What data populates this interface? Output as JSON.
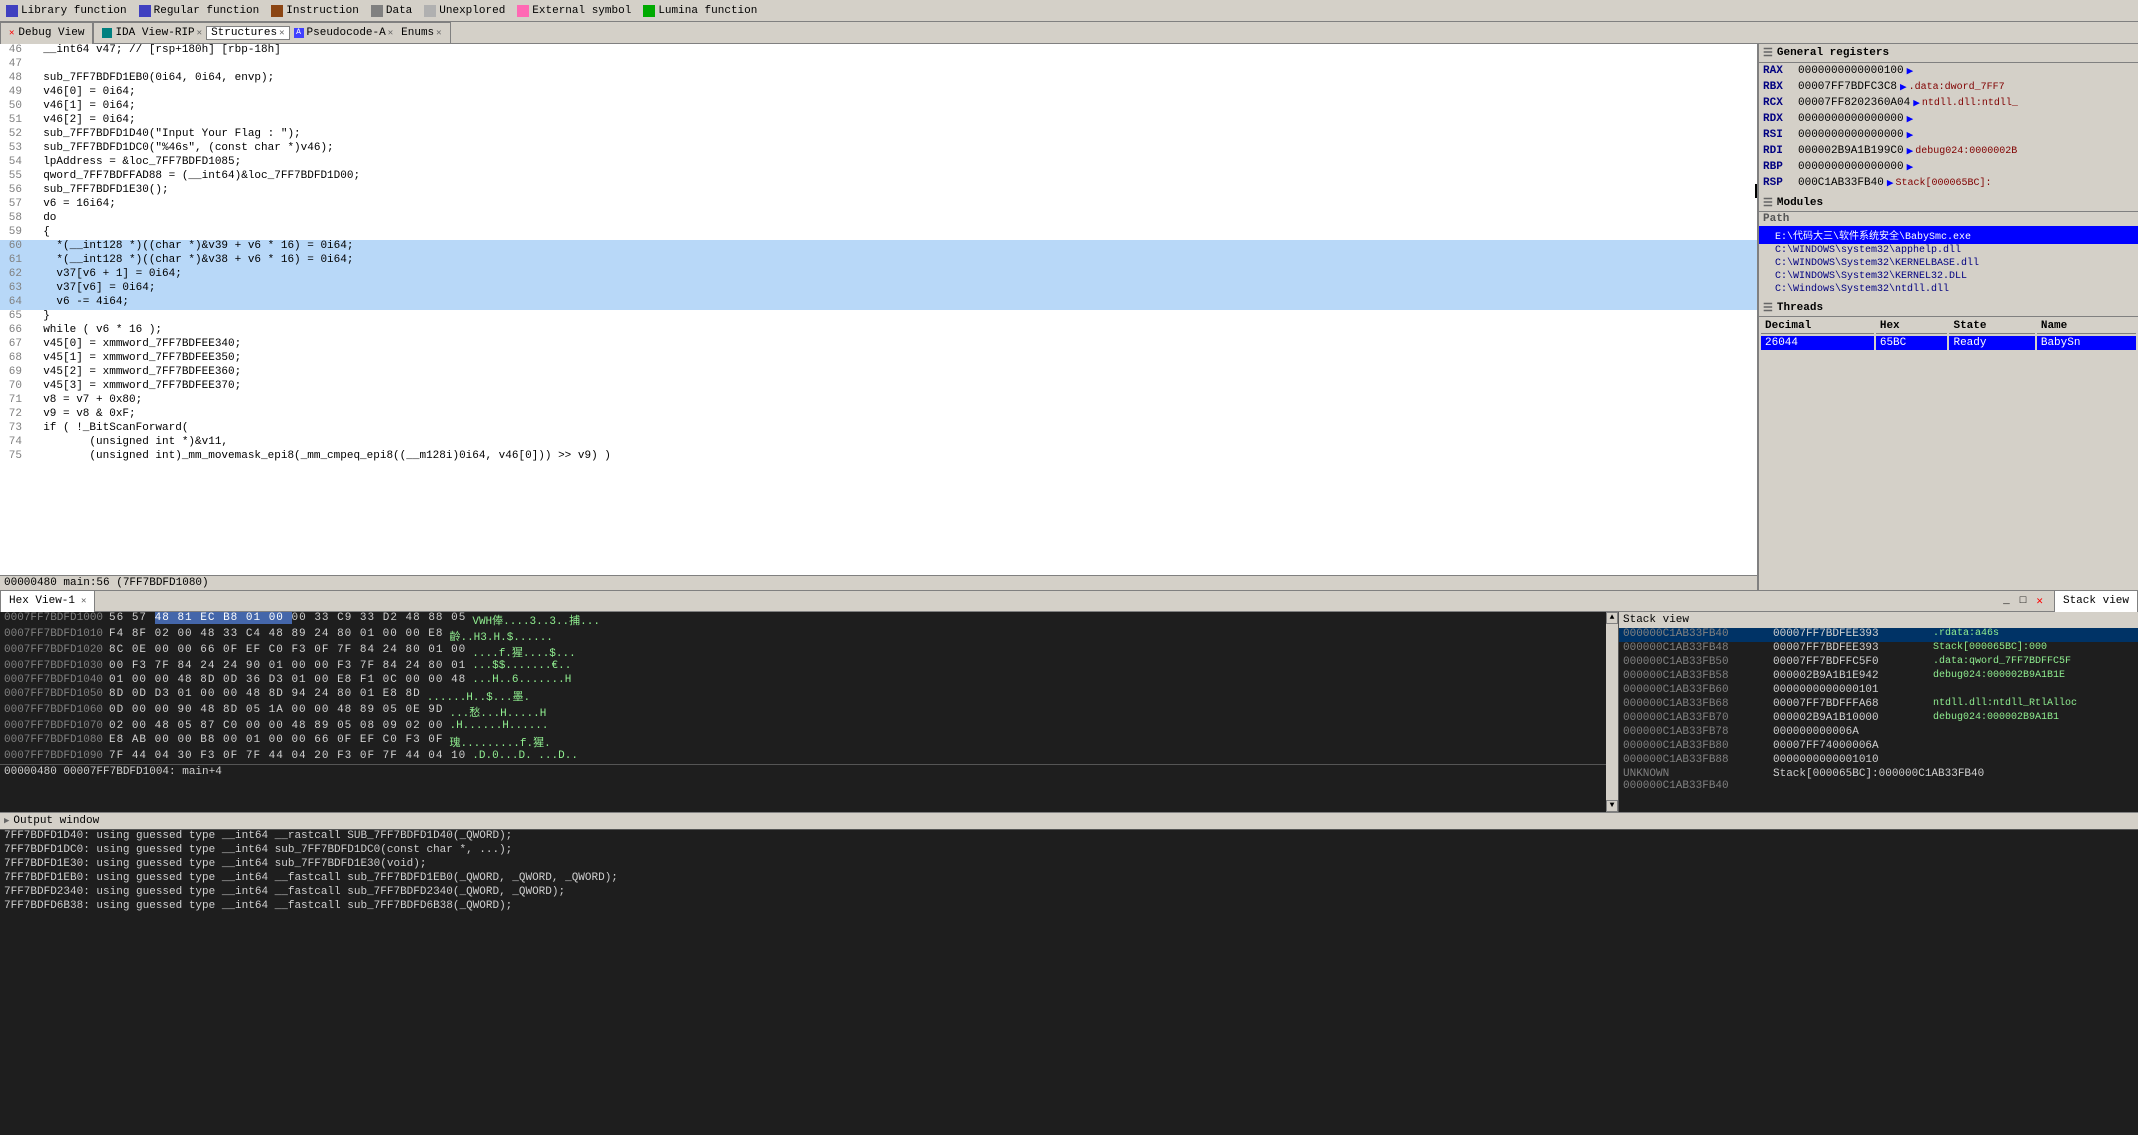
{
  "legend": {
    "items": [
      {
        "label": "Library function",
        "color": "#4040c0"
      },
      {
        "label": "Regular function",
        "color": "#4040c0"
      },
      {
        "label": "Instruction",
        "color": "#8b4513"
      },
      {
        "label": "Data",
        "color": "#808080"
      },
      {
        "label": "Unexplored",
        "color": "#808080"
      },
      {
        "label": "External symbol",
        "color": "#ff69b4"
      },
      {
        "label": "Lumina function",
        "color": "#00aa00"
      }
    ]
  },
  "tabs": {
    "debug_view": "Debug View",
    "ida_view_rip": "IDA View-RIP",
    "structures": "Structures",
    "pseudocode": "Pseudocode-A",
    "enums": "Enums"
  },
  "code_panel": {
    "title": "Pseudocode-A",
    "lines": [
      {
        "num": "46",
        "text": "  __int64 v47; // [rsp+180h] [rbp-18h]",
        "highlight": false
      },
      {
        "num": "47",
        "text": "",
        "highlight": false
      },
      {
        "num": "48",
        "text": "  sub_7FF7BDFD1EB0(0i64, 0i64, envp);",
        "highlight": false
      },
      {
        "num": "49",
        "text": "  v46[0] = 0i64;",
        "highlight": false
      },
      {
        "num": "50",
        "text": "  v46[1] = 0i64;",
        "highlight": false
      },
      {
        "num": "51",
        "text": "  v46[2] = 0i64;",
        "highlight": false
      },
      {
        "num": "52",
        "text": "  sub_7FF7BDFD1D40(\"Input Your Flag : \");",
        "highlight": false
      },
      {
        "num": "53",
        "text": "  sub_7FF7BDFD1DC0(\"%46s\", (const char *)v46);",
        "highlight": false
      },
      {
        "num": "54",
        "text": "  lpAddress = &loc_7FF7BDFD1085;",
        "highlight": false
      },
      {
        "num": "55",
        "text": "  qword_7FF7BDFFAD88 = (__int64)&loc_7FF7BDFD1D00;",
        "highlight": false
      },
      {
        "num": "56",
        "text": "  sub_7FF7BDFD1E30();",
        "highlight": false,
        "cursor": true
      },
      {
        "num": "57",
        "text": "  v6 = 16i64;",
        "highlight": false
      },
      {
        "num": "58",
        "text": "  do",
        "highlight": false
      },
      {
        "num": "59",
        "text": "  {",
        "highlight": false
      },
      {
        "num": "60",
        "text": "    *(__int128 *)((char *)&v39 + v6 * 16) = 0i64;",
        "highlight": true
      },
      {
        "num": "61",
        "text": "    *(__int128 *)((char *)&v38 + v6 * 16) = 0i64;",
        "highlight": true
      },
      {
        "num": "62",
        "text": "    v37[v6 + 1] = 0i64;",
        "highlight": true
      },
      {
        "num": "63",
        "text": "    v37[v6] = 0i64;",
        "highlight": true
      },
      {
        "num": "64",
        "text": "    v6 -= 4i64;",
        "highlight": true
      },
      {
        "num": "65",
        "text": "  }",
        "highlight": false
      },
      {
        "num": "66",
        "text": "  while ( v6 * 16 );",
        "highlight": false
      },
      {
        "num": "67",
        "text": "  v45[0] = xmmword_7FF7BDFEE340;",
        "highlight": false
      },
      {
        "num": "68",
        "text": "  v45[1] = xmmword_7FF7BDFEE350;",
        "highlight": false
      },
      {
        "num": "69",
        "text": "  v45[2] = xmmword_7FF7BDFEE360;",
        "highlight": false
      },
      {
        "num": "70",
        "text": "  v45[3] = xmmword_7FF7BDFEE370;",
        "highlight": false
      },
      {
        "num": "71",
        "text": "  v8 = v7 + 0x80;",
        "highlight": false
      },
      {
        "num": "72",
        "text": "  v9 = v8 & 0xF;",
        "highlight": false
      },
      {
        "num": "73",
        "text": "  if ( !_BitScanForward(",
        "highlight": false
      },
      {
        "num": "74",
        "text": "         (unsigned int *)&v11,",
        "highlight": false
      },
      {
        "num": "75",
        "text": "         (unsigned int)_mm_movemask_epi8(_mm_cmpeq_epi8((__m128i)0i64, v46[0])) >> v9) )",
        "highlight": false
      }
    ],
    "status": "00000480 main:56 (7FF7BDFD1080)"
  },
  "registers": {
    "title": "General registers",
    "items": [
      {
        "name": "RAX",
        "value": "0000000000000100",
        "ref": "▶",
        "ref_text": ""
      },
      {
        "name": "RBX",
        "value": "00007FF7BDFC3C8",
        "ref": "▶",
        "ref_text": ".data:dword_7FF7"
      },
      {
        "name": "RCX",
        "value": "00007FF8202360A04",
        "ref": "▶",
        "ref_text": "ntdll.dll:ntdll_"
      },
      {
        "name": "RDX",
        "value": "0000000000000000",
        "ref": "▶",
        "ref_text": ""
      },
      {
        "name": "RSI",
        "value": "0000000000000000",
        "ref": "▶",
        "ref_text": ""
      },
      {
        "name": "RDI",
        "value": "000002B9A1B199C0",
        "ref": "▶",
        "ref_text": "debug024:0000002B"
      },
      {
        "name": "RBP",
        "value": "0000000000000000",
        "ref": "▶",
        "ref_text": ""
      },
      {
        "name": "RSP",
        "value": "000C1AB33FB40",
        "ref": "▶",
        "ref_text": "Stack[000065BC]:"
      }
    ]
  },
  "modules": {
    "title": "Modules",
    "path_label": "Path",
    "items": [
      {
        "path": "E:\\代码大三\\软件系统安全\\BabySmc.exe",
        "selected": true
      },
      {
        "path": "C:\\WINDOWS\\system32\\apphelp.dll",
        "selected": false
      },
      {
        "path": "C:\\WINDOWS\\System32\\KERNELBASE.dll",
        "selected": false
      },
      {
        "path": "C:\\WINDOWS\\System32\\KERNEL32.DLL",
        "selected": false
      },
      {
        "path": "C:\\Windows\\System32\\ntdll.dll",
        "selected": false
      }
    ]
  },
  "threads": {
    "title": "Threads",
    "columns": [
      "Decimal",
      "Hex",
      "State",
      "Name"
    ],
    "rows": [
      {
        "decimal": "26044",
        "hex": "65BC",
        "state": "Ready",
        "name": "BabySn",
        "selected": true
      }
    ]
  },
  "hex_view": {
    "title": "Hex View-1",
    "rows": [
      {
        "addr": "0007FF7BDFD1000",
        "bytes": "56 57 48 81 EC B8 01 00  00 33 C9 33 D2 48 88 05",
        "ascii": "VWH俸....3..3..捕...",
        "selected_bytes": [
          2,
          3,
          4,
          5,
          6,
          7,
          8
        ]
      },
      {
        "addr": "0007FF7BDFD1010",
        "bytes": "F4 8F 02 00 48 33 C4 48  89 24 80 01 00 00 E8",
        "ascii": "齡..H3.H.$......"
      },
      {
        "addr": "0007FF7BDFD1020",
        "bytes": "8C 0E 00 00 66 0F EF C0  F3 0F 7F 84 24 80 01 00",
        "ascii": "....f.猩....$..."
      },
      {
        "addr": "0007FF7BDFD1030",
        "bytes": "00 F3 7F 84 24 24 90 01  00 00 F3 7F 84 24 80 01",
        "ascii": "...$$.......€.."
      },
      {
        "addr": "0007FF7BDFD1040",
        "bytes": "01 00 00 48 8D 0D 36 D3  01 00 E8 F1 0C 00 00 48",
        "ascii": "...H..6.......H"
      },
      {
        "addr": "0007FF7BDFD1050",
        "bytes": "8D 0D D3 01 00 00 48 8D  94 24 80 01 E8 8D",
        "ascii": "......H..$...墨."
      },
      {
        "addr": "0007FF7BDFD1060",
        "bytes": "0D 00 00 90 48 8D 05 1A  00 00 48 89 05 0E 9D",
        "ascii": "...愁...H.....H"
      },
      {
        "addr": "0007FF7BDFD1070",
        "bytes": "02 00 48 05 87 C0 00 00  48 89 05 08 09 02 00",
        "ascii": ".H......H......"
      },
      {
        "addr": "0007FF7BDFD1080",
        "bytes": "E8 AB 00 00 B8 00 01 00  00 66 0F EF C0 F3 0F",
        "ascii": "瑰.........f.猩."
      },
      {
        "addr": "0007FF7BDFD1090",
        "bytes": "7F 44 04 30 F3 0F 7F 44  04 20 F3 0F 7F 44 04 10",
        "ascii": ".D.0...D. ...D.."
      }
    ],
    "selected_addr": "00000480 00007FF7BDFD1004: main+4"
  },
  "stack_view": {
    "title": "Stack view",
    "rows": [
      {
        "addr": "000000C1AB33FB40",
        "val": "00007FF7BDFEE393",
        "ref": ".rdata:a46s",
        "selected": true
      },
      {
        "addr": "000000C1AB33FB48",
        "val": "00007FF7BDFEE393",
        "ref": "Stack[000065BC]:000"
      },
      {
        "addr": "000000C1AB33FB50",
        "val": "00007FF7BDFFC5F0",
        "ref": ".data:qword_7FF7BDFFC5F"
      },
      {
        "addr": "000000C1AB33FB58",
        "val": "000002B9A1B1E942",
        "ref": "debug024:000002B9A1B1E"
      },
      {
        "addr": "000000C1AB33FB60",
        "val": "0000000000000101",
        "ref": ""
      },
      {
        "addr": "000000C1AB33FB68",
        "val": "00007FF7BDFFFA68",
        "ref": "ntdll.dll:ntdll_RtlAlloc"
      },
      {
        "addr": "000000C1AB33FB70",
        "val": "000002B9A1B10000",
        "ref": "debug024:000002B9A1B1"
      },
      {
        "addr": "000000C1AB33FB78",
        "val": "000000000006A",
        "ref": ""
      },
      {
        "addr": "000000C1AB33FB80",
        "val": "00007FF74000006A",
        "ref": ""
      },
      {
        "addr": "000000C1AB33FB88",
        "val": "0000000000001010",
        "ref": ""
      },
      {
        "addr": "UNKNOWN 000000C1AB33FB40",
        "val": "Stack[000065BC]:000000C1AB33FB40",
        "ref": ""
      }
    ]
  },
  "output_window": {
    "title": "Output window",
    "lines": [
      "7FF7BDFD1D40: using guessed type __int64 __rastcall SUB_7FF7BDFD1D40(_QWORD);",
      "7FF7BDFD1DC0: using guessed type __int64 sub_7FF7BDFD1DC0(const char *, ...);",
      "7FF7BDFD1E30: using guessed type __int64 sub_7FF7BDFD1E30(void);",
      "7FF7BDFD1EB0: using guessed type __int64 __fastcall sub_7FF7BDFD1EB0(_QWORD, _QWORD, _QWORD);",
      "7FF7BDFD2340: using guessed type __int64 __fastcall sub_7FF7BDFD2340(_QWORD, _QWORD);",
      "7FF7BDFD6B38: using guessed type __int64 __fastcall sub_7FF7BDFD6B38(_QWORD);"
    ]
  }
}
